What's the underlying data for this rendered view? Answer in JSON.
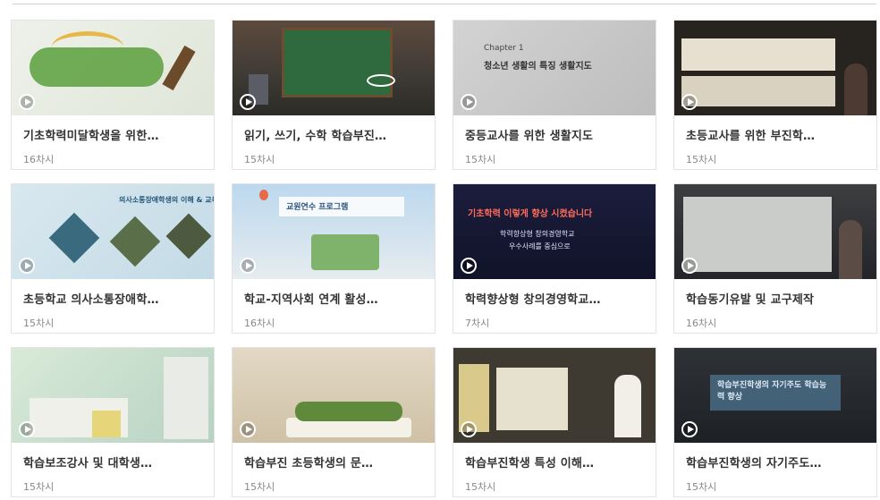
{
  "courses": [
    {
      "title": "기초학력미달학생을 위한…",
      "meta": "16차시"
    },
    {
      "title": "읽기, 쓰기, 수학 학습부진…",
      "meta": "15차시"
    },
    {
      "title": "중등교사를 위한 생활지도",
      "meta": "15차시"
    },
    {
      "title": "초등교사를 위한 부진학…",
      "meta": "15차시"
    },
    {
      "title": "초등학교 의사소통장애학…",
      "meta": "15차시"
    },
    {
      "title": "학교-지역사회 연계 활성…",
      "meta": "16차시"
    },
    {
      "title": "학력향상형 창의경영학교…",
      "meta": "7차시"
    },
    {
      "title": "학습동기유발 및 교구제작",
      "meta": "16차시"
    },
    {
      "title": "학습보조강사 및 대학생…",
      "meta": "15차시"
    },
    {
      "title": "학습부진 초등학생의 문…",
      "meta": "15차시"
    },
    {
      "title": "학습부진학생 특성 이해…",
      "meta": "15차시"
    },
    {
      "title": "학습부진학생의 자기주도…",
      "meta": "15차시"
    }
  ],
  "thumbnail_text": {
    "c2_chapter": "Chapter 1",
    "c2_title": "청소년 생활의 특징 생활지도",
    "c4_caption": "의사소통장애학생의 이해 & 교육",
    "c5_caption": "교원연수 프로그램",
    "c6_line1": "기초학력 이렇게 향상 시켰습니다",
    "c6_line2": "학력향상형 창의경영학교",
    "c6_line3": "우수사례를 중심으로",
    "c11_caption": "학습부진학생의 자기주도 학습능력 향상"
  },
  "icons": {
    "play": "play-icon"
  }
}
